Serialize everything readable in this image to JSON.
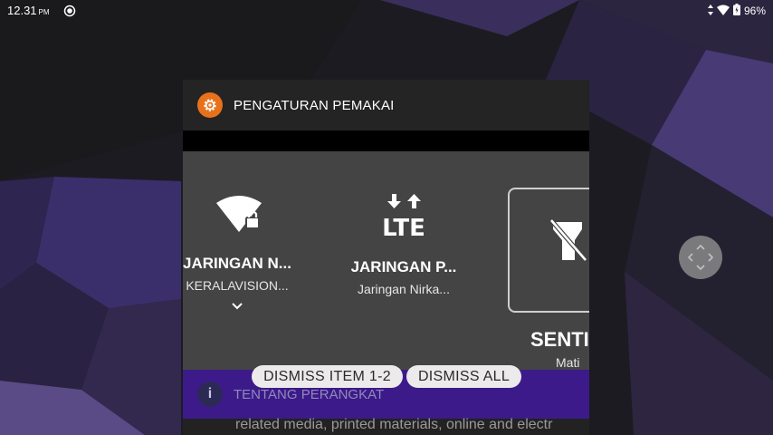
{
  "status_bar": {
    "time": "12.31",
    "ampm": "PM",
    "battery": "96%",
    "left_icon": "cast-icon",
    "right_icons": [
      "data-arrows-icon",
      "wifi-icon",
      "battery-icon"
    ]
  },
  "card": {
    "app_icon": "gear-icon",
    "app_icon_color": "#e8711c",
    "title": "PENGATURAN PEMAKAI",
    "tiles": [
      {
        "icon": "wifi-lock-icon",
        "title": "JARINGAN N...",
        "subtitle": "KERALAVISION...",
        "expand_icon": "chevron-down-icon"
      },
      {
        "icon": "lte-icon",
        "title": "JARINGAN P...",
        "subtitle": "Jaringan Nirka..."
      },
      {
        "icon": "flashlight-off-icon",
        "title": "SENTI",
        "subtitle": "Mati"
      }
    ],
    "about": {
      "icon": "info-icon",
      "label": "TENTANG PERANGKAT",
      "color": "#3c1a8a"
    },
    "body_text": "related media, printed materials, online and electr"
  },
  "dismiss": {
    "item_label": "DISMISS ITEM 1-2",
    "all_label": "DISMISS ALL"
  },
  "nav_handle": {
    "icon": "directional-pad-icon"
  }
}
